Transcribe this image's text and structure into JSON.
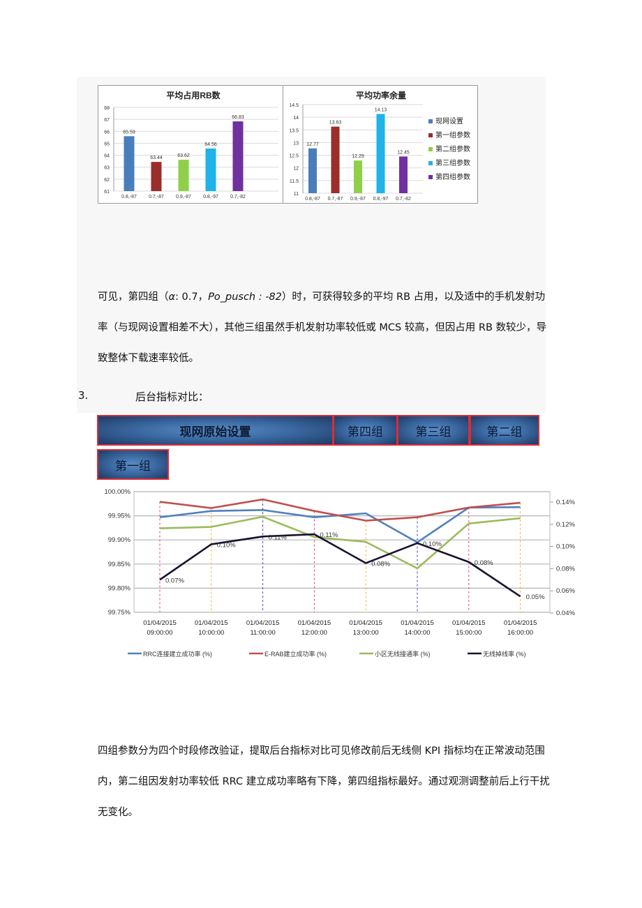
{
  "document": {
    "paragraph1": {
      "p1": "可见，第四组（",
      "alpha": "α",
      "p2": ": 0.7，",
      "italic": "Po_pusch : -82",
      "p3": "）时，可获得较多的平均 RB 占用，以及适中的手机发射功率（与现网设置相差不大），其他三组虽然手机发射功率较低或 MCS 较高，但因占用 RB 数较少，导致整体下载速率较低。"
    },
    "section": {
      "number": "3.",
      "title": "后台指标对比："
    },
    "tabs": [
      {
        "label": "现网原始设置"
      },
      {
        "label": "第四组"
      },
      {
        "label": "第三组"
      },
      {
        "label": "第二组"
      },
      {
        "label": "第一组"
      }
    ],
    "paragraph2": "四组参数分为四个时段修改验证，提取后台指标对比可见修改前后无线侧 KPI 指标均在正常波动范围内，第二组因发射功率较低 RRC 建立成功率略有下降，第四组指标最好。通过观测调整前后上行干扰无变化。"
  },
  "chart_data": [
    {
      "type": "bar",
      "title": "平均占用RB数",
      "categories": [
        "0.8,-87",
        "0.7,-87",
        "0.9,-87",
        "0.8,-97",
        "0.7,-82"
      ],
      "values": [
        65.59,
        63.44,
        63.62,
        64.56,
        66.83
      ],
      "value_labels": [
        "65.59",
        "63.44",
        "63.62",
        "64.56",
        "66.83"
      ],
      "colors": [
        "#4a7ebb",
        "#9b2d2a",
        "#8fcf4a",
        "#1fb3ea",
        "#7030a0"
      ],
      "ylim": [
        61,
        68
      ],
      "yticks": [
        "61",
        "62",
        "63",
        "64",
        "65",
        "66",
        "67",
        "68"
      ],
      "grid": true
    },
    {
      "type": "bar",
      "title": "平均功率余量",
      "categories": [
        "0.8,-87",
        "0.7,-87",
        "0.9,-87",
        "0.8,-97",
        "0.7,-82"
      ],
      "values": [
        12.77,
        13.63,
        12.29,
        14.13,
        12.45
      ],
      "value_labels": [
        "12.77",
        "13.63",
        "12.29",
        "14.13",
        "12.45"
      ],
      "colors": [
        "#4a7ebb",
        "#9b2d2a",
        "#8fcf4a",
        "#1fb3ea",
        "#7030a0"
      ],
      "ylim": [
        11,
        14.5
      ],
      "yticks": [
        "11",
        "11.5",
        "12",
        "12.5",
        "13",
        "13.5",
        "14",
        "14.5"
      ],
      "legend": [
        "现网设置",
        "第一组参数",
        "第二组参数",
        "第三组参数",
        "第四组参数"
      ],
      "legend_position": "right",
      "grid": true
    },
    {
      "type": "line",
      "title": "",
      "x": [
        "01/04/2015 09:00:00",
        "01/04/2015 10:00:00",
        "01/04/2015 11:00:00",
        "01/04/2015 12:00:00",
        "01/04/2015 13:00:00",
        "01/04/2015 14:00:00",
        "01/04/2015 15:00:00",
        "01/04/2015 16:00:00"
      ],
      "x_line1": [
        "01/04/2015",
        "01/04/2015",
        "01/04/2015",
        "01/04/2015",
        "01/04/2015",
        "01/04/2015",
        "01/04/2015",
        "01/04/2015"
      ],
      "x_line2": [
        "09:00:00",
        "10:00:00",
        "11:00:00",
        "12:00:00",
        "13:00:00",
        "14:00:00",
        "15:00:00",
        "16:00:00"
      ],
      "ylim_left": [
        99.75,
        100.0
      ],
      "yticks_left": [
        "99.75%",
        "99.80%",
        "99.85%",
        "99.90%",
        "99.95%",
        "100.00%"
      ],
      "ylim_right": [
        0.04,
        0.15
      ],
      "yticks_right": [
        "0.04%",
        "0.06%",
        "0.08%",
        "0.10%",
        "0.12%",
        "0.14%"
      ],
      "grid": true,
      "legend_position": "bottom",
      "series": [
        {
          "name": "RRC连接建立成功率 (%)",
          "axis": "left",
          "color": "#4f81bd",
          "values": [
            99.947,
            99.96,
            99.962,
            99.947,
            99.955,
            99.895,
            99.967,
            99.968
          ]
        },
        {
          "name": "E-RAB建立成功率 (%)",
          "axis": "left",
          "color": "#c0504d",
          "values": [
            99.979,
            99.966,
            99.984,
            99.96,
            99.94,
            99.947,
            99.967,
            99.977
          ]
        },
        {
          "name": "小区无线接通率 (%)",
          "axis": "left",
          "color": "#9bbb59",
          "values": [
            99.924,
            99.927,
            99.948,
            99.906,
            99.896,
            99.841,
            99.934,
            99.945
          ]
        },
        {
          "name": "无线掉线率 (%)",
          "axis": "right",
          "color": "#1a1030",
          "values": [
            0.07,
            0.102,
            0.109,
            0.111,
            0.085,
            0.103,
            0.086,
            0.055
          ],
          "data_labels": [
            "0.07%",
            "0.10%",
            "0.11%",
            "0.11%",
            "0.08%",
            "0.10%",
            "0.08%",
            "0.05%"
          ]
        }
      ]
    }
  ]
}
